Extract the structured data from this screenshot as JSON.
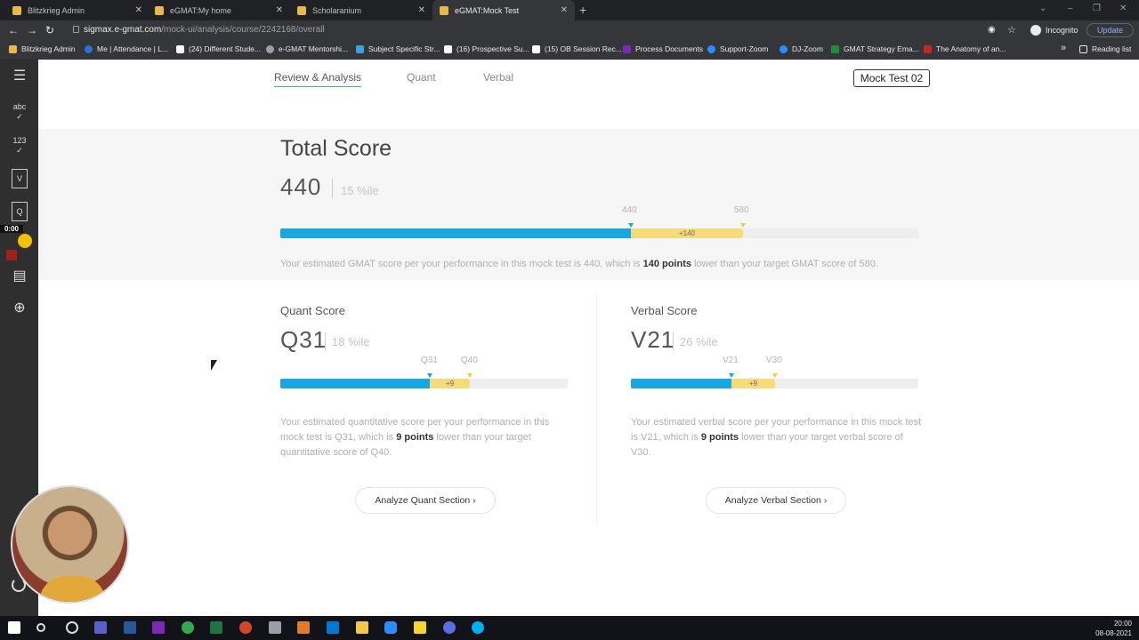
{
  "browser": {
    "tabs": [
      {
        "label": "Blitzkrieg Admin"
      },
      {
        "label": "eGMAT:My home"
      },
      {
        "label": "Scholaranium"
      },
      {
        "label": "eGMAT:Mock Test"
      }
    ],
    "url_host": "sigmax.e-gmat.com",
    "url_path": "/mock-ui/analysis/course/2242168/overall",
    "incognito_label": "Incognito",
    "update_label": "Update",
    "bookmarks": [
      "Blitzkrieg Admin",
      "Me | Attendance | L...",
      "(24) Different Stude...",
      "e-GMAT Mentorshi...",
      "Subject Specific Str...",
      "(16) Prospective Su...",
      "(15) OB Session Rec...",
      "Process Documents",
      "Support-Zoom",
      "DJ-Zoom",
      "GMAT Strategy Ema...",
      "The Anatomy of an..."
    ],
    "reading_list": "Reading list"
  },
  "sidebar": {
    "abc_label": "abc",
    "num_label": "123",
    "v_label": "V",
    "q_label": "Q",
    "timer": "0:00"
  },
  "nav": {
    "tabs": [
      "Review & Analysis",
      "Quant",
      "Verbal"
    ],
    "mock_button": "Mock Test 02"
  },
  "total": {
    "title": "Total Score",
    "score": "440",
    "percentile": "15 %ile",
    "marker_current": "440",
    "marker_target": "580",
    "gap_label": "+140",
    "progress_fraction": 0.55,
    "target_fraction": 0.725,
    "desc_pre": "Your estimated GMAT score per your performance in this mock test is 440, which is ",
    "desc_bold": "140 points",
    "desc_post": " lower than your target GMAT score of 580."
  },
  "quant": {
    "title": "Quant Score",
    "score": "Q31",
    "percentile": "18 %ile",
    "marker_current": "Q31",
    "marker_target": "Q40",
    "gap_label": "+9",
    "progress_fraction": 0.52,
    "target_fraction": 0.66,
    "desc_pre": "Your estimated quantitative score per your performance in this mock test is Q31, which is ",
    "desc_bold": "9 points",
    "desc_post": " lower than your target quantitative score of Q40.",
    "button": "Analyze Quant Section ›"
  },
  "verbal": {
    "title": "Verbal Score",
    "score": "V21",
    "percentile": "26 %ile",
    "marker_current": "V21",
    "marker_target": "V30",
    "gap_label": "+9",
    "progress_fraction": 0.35,
    "target_fraction": 0.5,
    "desc_pre": "Your estimated verbal score per your performance in this mock test is V21, which is ",
    "desc_bold": "9 points",
    "desc_post": " lower than your target verbal score of V30.",
    "button": "Analyze Verbal Section ›"
  },
  "taskbar": {
    "time": "20:00",
    "date": "08-08-2021"
  },
  "colors": {
    "progress_blue": "#1aa6df",
    "gap_yellow": "#f7db7a",
    "sidebar_bg": "#2f2f2f"
  }
}
